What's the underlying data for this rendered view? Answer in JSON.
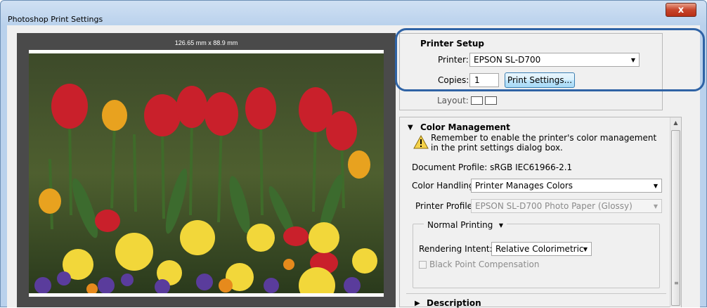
{
  "window": {
    "title": "Photoshop Print Settings",
    "close_label": "x"
  },
  "preview": {
    "dimensions": "126.65 mm x 88.9 mm"
  },
  "printer_setup": {
    "heading": "Printer Setup",
    "printer_label": "Printer:",
    "printer_value": "EPSON SL-D700",
    "copies_label": "Copies:",
    "copies_value": "1",
    "print_settings_button": "Print Settings...",
    "layout_label": "Layout:"
  },
  "color_management": {
    "heading": "Color Management",
    "notice": "Remember to enable the printer's color management in the print settings dialog box.",
    "document_profile": "Document Profile: sRGB IEC61966-2.1",
    "color_handling_label": "Color Handling:",
    "color_handling_value": "Printer Manages Colors",
    "printer_profile_label": "Printer Profile:",
    "printer_profile_value": "EPSON SL-D700 Photo Paper (Glossy)",
    "printing_mode_value": "Normal Printing",
    "rendering_intent_label": "Rendering Intent:",
    "rendering_intent_value": "Relative Colorimetric",
    "black_point_label": "Black Point Compensation",
    "black_point_checked": false
  },
  "description": {
    "heading": "Description"
  },
  "icons": {
    "expand_arrow": "triangle-down",
    "collapse_arrow": "triangle-right",
    "warning": "warning-icon"
  }
}
